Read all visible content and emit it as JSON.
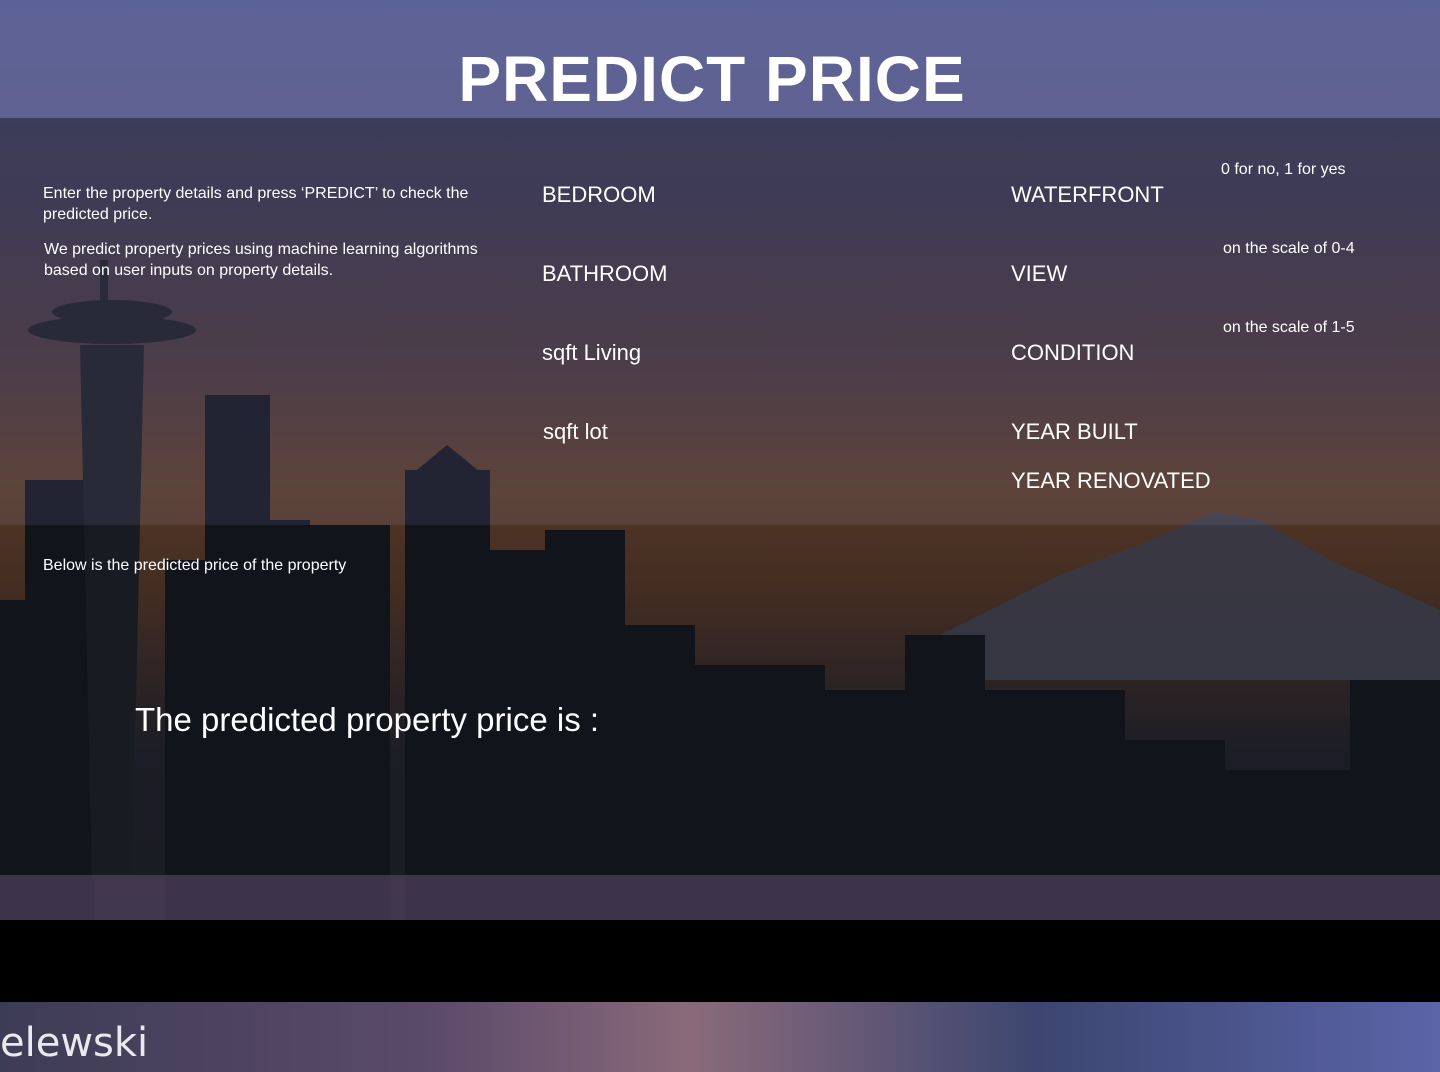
{
  "header": {
    "title": "PREDICT PRICE"
  },
  "intro": {
    "instructions": "Enter the property details and press ‘PREDICT’ to check the predicted price.",
    "description": "We predict property prices using machine learning algorithms based on user inputs on property details."
  },
  "form": {
    "left_fields": [
      {
        "label": "BEDROOM"
      },
      {
        "label": "BATHROOM"
      },
      {
        "label": "sqft Living"
      },
      {
        "label": "sqft lot"
      }
    ],
    "right_fields": [
      {
        "label": "WATERFRONT",
        "hint": "0 for no, 1 for yes"
      },
      {
        "label": "VIEW",
        "hint": "on the scale of 0-4"
      },
      {
        "label": "CONDITION",
        "hint": "on the scale of 1-5"
      },
      {
        "label": "YEAR BUILT"
      },
      {
        "label": "YEAR RENOVATED"
      }
    ]
  },
  "result": {
    "intro": "Below is the predicted price of the property",
    "label": "The predicted property price is :"
  },
  "photo_credit": "elewski"
}
